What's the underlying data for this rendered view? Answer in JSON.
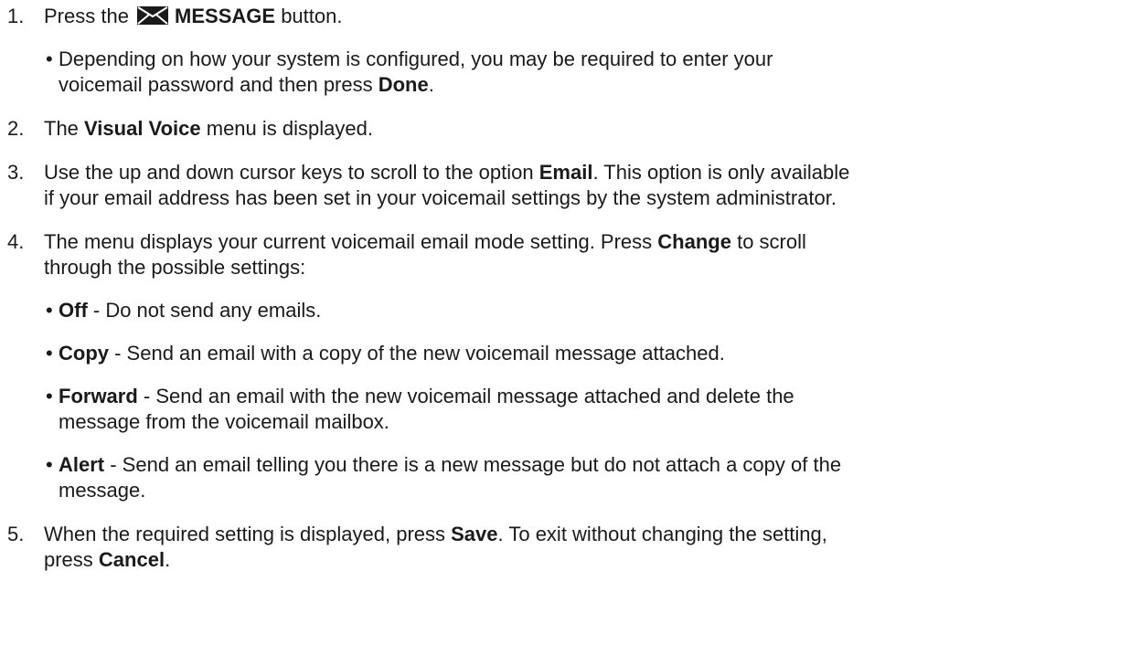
{
  "steps": [
    {
      "num": "1.",
      "pre": "Press the ",
      "icon": "envelope-icon",
      "bold": "MESSAGE",
      "post": " button.",
      "subs": [
        {
          "line1_pre": "Depending on how your system is configured, you may be required to enter your",
          "line2_pre": "voicemail password and then press ",
          "bold": "Done",
          "post": "."
        }
      ]
    },
    {
      "num": "2.",
      "pre": "The ",
      "bold": "Visual Voice",
      "post": " menu is displayed."
    },
    {
      "num": "3.",
      "pre": "Use the up and down cursor keys to scroll to the option ",
      "bold": "Email",
      "post": ". This option is only available",
      "line2": "if your email address has been set in your voicemail settings by the system administrator."
    },
    {
      "num": "4.",
      "pre": "The menu displays your current voicemail email mode setting. Press ",
      "bold": "Change",
      "post": " to scroll",
      "line2": "through the possible settings:",
      "subs": [
        {
          "bold": "Off",
          "text": " - Do not send any emails."
        },
        {
          "bold": "Copy",
          "text": " - Send an email with a copy of the new voicemail message attached."
        },
        {
          "bold": "Forward",
          "text": " - Send an email with the new voicemail message attached and delete the",
          "line2": "message from the voicemail mailbox."
        },
        {
          "bold": "Alert",
          "text": " - Send an email telling you there is a new message but do not attach a copy of the",
          "line2": "message."
        }
      ]
    },
    {
      "num": "5.",
      "pre": "When the required setting is displayed, press ",
      "bold": "Save",
      "post": ". To exit without changing the setting,",
      "line2_pre": "press ",
      "line2_bold": "Cancel",
      "line2_post": "."
    }
  ],
  "bullet": "•"
}
